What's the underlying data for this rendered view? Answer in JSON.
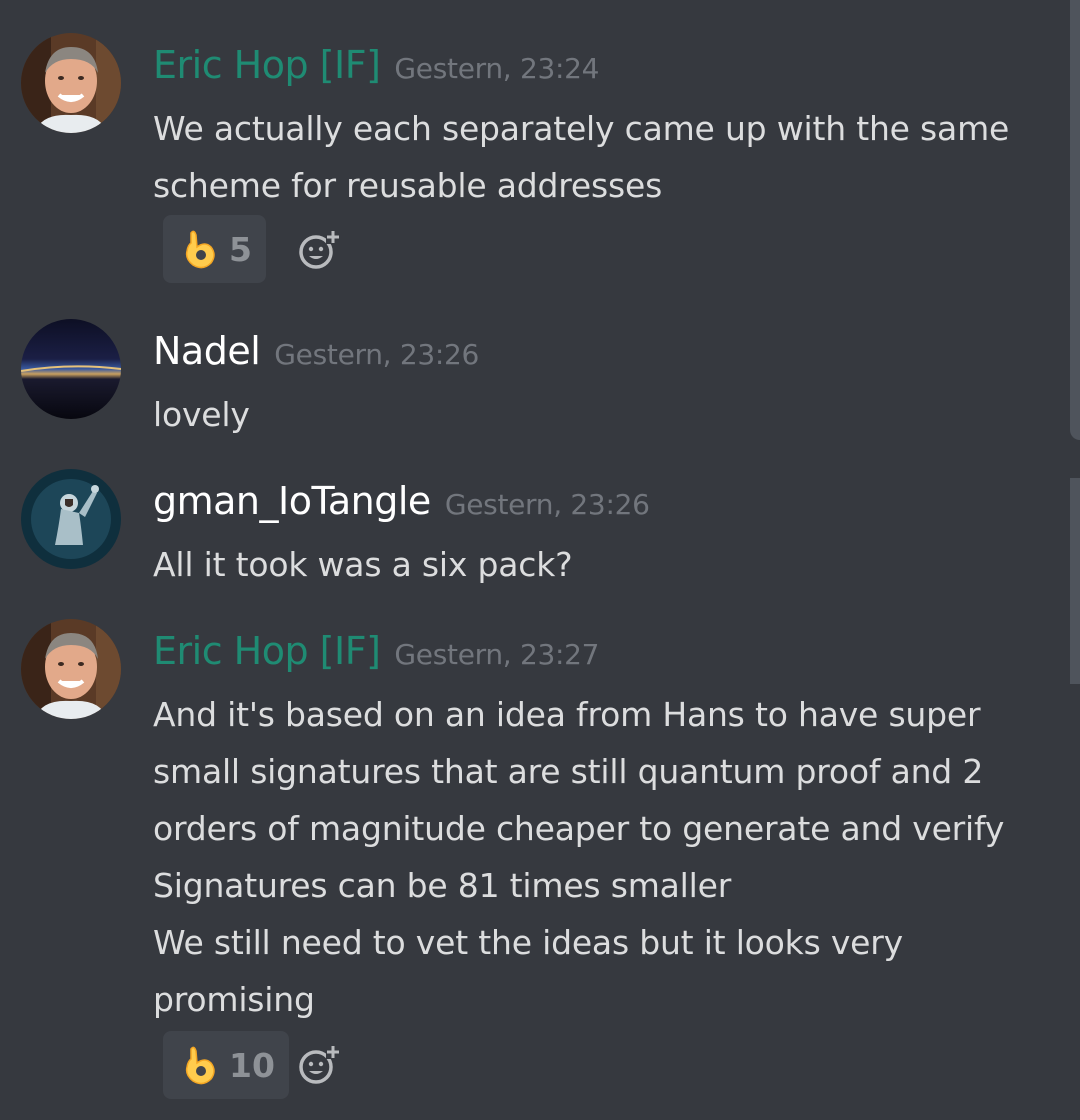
{
  "messages": [
    {
      "author": "Eric Hop [IF]",
      "timestamp": "Gestern, 23:24",
      "lines": [
        "We actually each separately came up with the same",
        "scheme for reusable addresses"
      ],
      "reaction": {
        "emoji": "ok-hand",
        "count": "5"
      }
    },
    {
      "author": "Nadel",
      "timestamp": "Gestern, 23:26",
      "lines": [
        "lovely"
      ]
    },
    {
      "author": "gman_IoTangle",
      "timestamp": "Gestern, 23:26",
      "lines": [
        "All it took was a six pack?"
      ]
    },
    {
      "author": "Eric Hop [IF]",
      "timestamp": "Gestern, 23:27",
      "lines": [
        "And it's based on an idea from Hans to have super",
        "small signatures that are still quantum proof and 2",
        "orders of magnitude cheaper to generate and verify",
        "Signatures can be 81 times smaller",
        "We still need to vet the ideas but it looks very",
        "promising"
      ],
      "reaction": {
        "emoji": "ok-hand",
        "count": "10"
      }
    }
  ],
  "icons": {
    "reaction_emoji": "ok-hand-icon",
    "add_reaction": "add-reaction-icon"
  },
  "colors": {
    "background": "#36393f",
    "role_color": "#1f8b73",
    "username_default": "#ffffff",
    "message_text": "#dcddde",
    "timestamp": "#72767d",
    "reaction_bg": "#40444b",
    "reaction_count": "#8e9297",
    "emoji_yellow": "#ffcc4d"
  }
}
